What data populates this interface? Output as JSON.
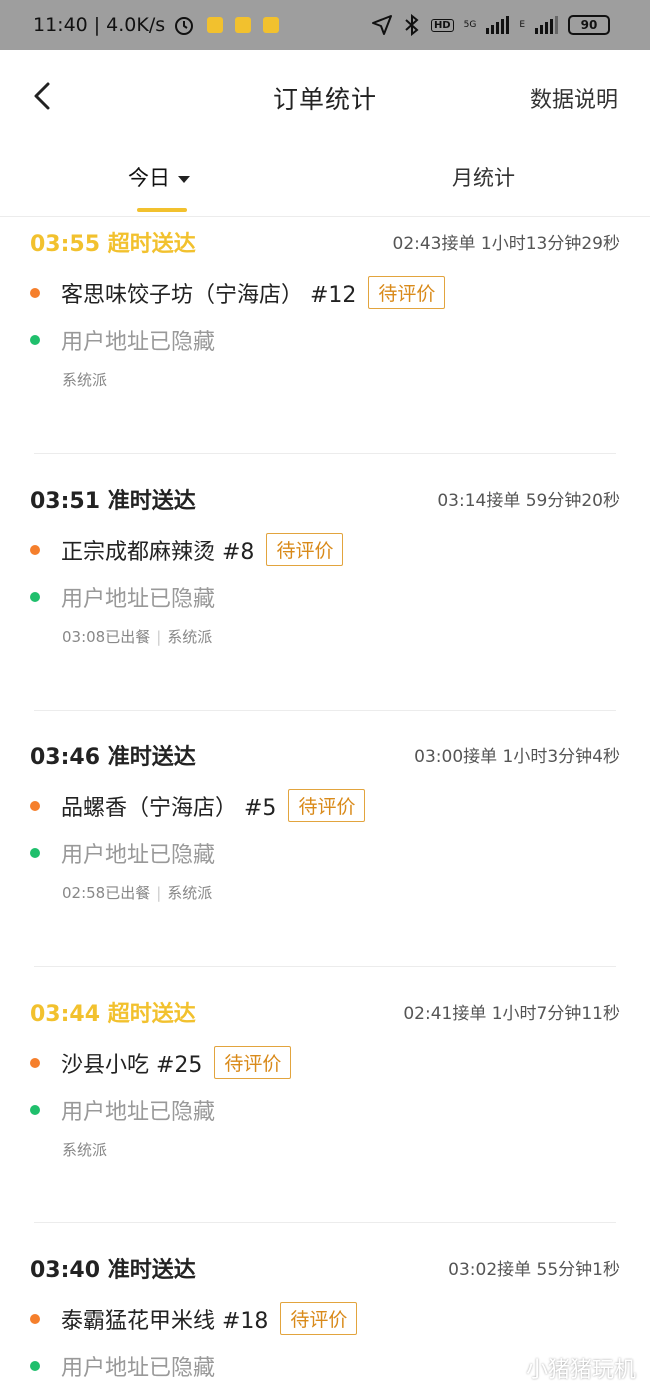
{
  "status_bar": {
    "time": "11:40",
    "speed": "4.0K/s",
    "network_1": "5G",
    "network_2": "E",
    "hd": "HD",
    "battery": "90"
  },
  "nav": {
    "title": "订单统计",
    "action": "数据说明"
  },
  "tabs": {
    "today": "今日",
    "month": "月统计"
  },
  "orders": [
    {
      "time": "03:55",
      "status": "超时送达",
      "accepted": "02:43接单",
      "duration": "1小时13分钟29秒",
      "store": "客思味饺子坊（宁海店） #12",
      "tag": "待评价",
      "address": "用户地址已隐藏",
      "meal_out": "",
      "dispatch": "系统派",
      "overdue": true
    },
    {
      "time": "03:51",
      "status": "准时送达",
      "accepted": "03:14接单",
      "duration": "59分钟20秒",
      "store": "正宗成都麻辣烫 #8",
      "tag": "待评价",
      "address": "用户地址已隐藏",
      "meal_out": "03:08已出餐",
      "dispatch": "系统派",
      "overdue": false
    },
    {
      "time": "03:46",
      "status": "准时送达",
      "accepted": "03:00接单",
      "duration": "1小时3分钟4秒",
      "store": "品螺香（宁海店） #5",
      "tag": "待评价",
      "address": "用户地址已隐藏",
      "meal_out": "02:58已出餐",
      "dispatch": "系统派",
      "overdue": false
    },
    {
      "time": "03:44",
      "status": "超时送达",
      "accepted": "02:41接单",
      "duration": "1小时7分钟11秒",
      "store": "沙县小吃 #25",
      "tag": "待评价",
      "address": "用户地址已隐藏",
      "meal_out": "",
      "dispatch": "系统派",
      "overdue": true
    },
    {
      "time": "03:40",
      "status": "准时送达",
      "accepted": "03:02接单",
      "duration": "55分钟1秒",
      "store": "泰霸猛花甲米线 #18",
      "tag": "待评价",
      "address": "用户地址已隐藏",
      "meal_out": "",
      "dispatch": "",
      "overdue": false
    }
  ],
  "colors": {
    "overdue": "#f2c12e",
    "accent": "#f2c12e",
    "tag": "#d98a1a",
    "dot_store": "#f57f2c",
    "dot_address": "#1fbf6c"
  },
  "watermark": "小猪猪玩机"
}
